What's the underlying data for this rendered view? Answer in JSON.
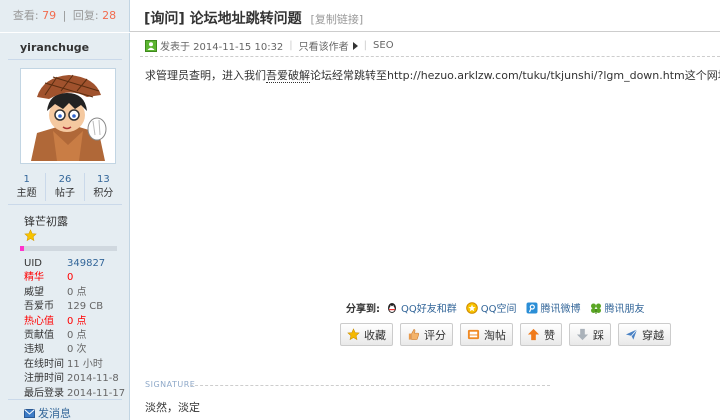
{
  "thread": {
    "views_label": "查看:",
    "views": "79",
    "replies_label": "回复:",
    "replies": "28",
    "title": "[询问] 论坛地址跳转问题",
    "copy_link": "[复制链接]"
  },
  "author": {
    "username": "yiranchuge",
    "counts": [
      {
        "value": "1",
        "label": "主题"
      },
      {
        "value": "26",
        "label": "帖子"
      },
      {
        "value": "13",
        "label": "积分"
      }
    ],
    "rank": "锋芒初露",
    "level_progress": 0.04,
    "level_color": "#ff33cc",
    "profile": [
      {
        "key": "UID",
        "value": "349827",
        "style": "link"
      },
      {
        "key": "精华",
        "value": "0",
        "style": "red"
      },
      {
        "key": "威望",
        "value": "0 点",
        "style": ""
      },
      {
        "key": "吾爱币",
        "value": "129 CB",
        "style": ""
      },
      {
        "key": "热心值",
        "value": "0 点",
        "style": "red"
      },
      {
        "key": "贡献值",
        "value": "0 点",
        "style": ""
      },
      {
        "key": "违规",
        "value": "0 次",
        "style": ""
      },
      {
        "key": "在线时间",
        "value": "11 小时",
        "style": ""
      },
      {
        "key": "注册时间",
        "value": "2014-11-8",
        "style": ""
      },
      {
        "key": "最后登录",
        "value": "2014-11-17",
        "style": ""
      }
    ],
    "send_message": "发消息"
  },
  "post": {
    "posted_on": "发表于 2014-11-15 10:32",
    "only_author": "只看该作者",
    "seo": "SEO",
    "body_prefix": "求管理员查明，进入我们",
    "body_keyword": "吾爱破解",
    "body_suffix": "论坛经常跳转至http://hezuo.arklzw.com/tuku/tkjunshi/?lgm_down.htm这个网址"
  },
  "share": {
    "label": "分享到:",
    "items": [
      {
        "label": "QQ好友和群",
        "icon": "qq-icon"
      },
      {
        "label": "QQ空间",
        "icon": "qzone-icon"
      },
      {
        "label": "腾讯微博",
        "icon": "tweibo-icon"
      },
      {
        "label": "腾讯朋友",
        "icon": "pengyou-icon"
      }
    ]
  },
  "actions": {
    "favorite": "收藏",
    "rate": "评分",
    "tao": "淘帖",
    "like": "赞",
    "dislike": "踩",
    "pass": "穿越"
  },
  "signature": {
    "label": "SIGNATURE",
    "text": "淡然，淡定"
  },
  "colors": {
    "sidebar_bg": "#e5edf2",
    "link": "#336699",
    "count_highlight": "#f26c4f"
  }
}
